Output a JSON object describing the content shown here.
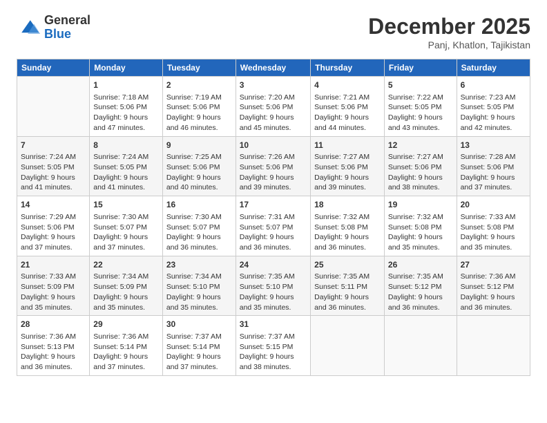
{
  "logo": {
    "general": "General",
    "blue": "Blue"
  },
  "title": "December 2025",
  "subtitle": "Panj, Khatlon, Tajikistan",
  "days_header": [
    "Sunday",
    "Monday",
    "Tuesday",
    "Wednesday",
    "Thursday",
    "Friday",
    "Saturday"
  ],
  "weeks": [
    [
      {
        "day": "",
        "lines": []
      },
      {
        "day": "1",
        "lines": [
          "Sunrise: 7:18 AM",
          "Sunset: 5:06 PM",
          "Daylight: 9 hours",
          "and 47 minutes."
        ]
      },
      {
        "day": "2",
        "lines": [
          "Sunrise: 7:19 AM",
          "Sunset: 5:06 PM",
          "Daylight: 9 hours",
          "and 46 minutes."
        ]
      },
      {
        "day": "3",
        "lines": [
          "Sunrise: 7:20 AM",
          "Sunset: 5:06 PM",
          "Daylight: 9 hours",
          "and 45 minutes."
        ]
      },
      {
        "day": "4",
        "lines": [
          "Sunrise: 7:21 AM",
          "Sunset: 5:06 PM",
          "Daylight: 9 hours",
          "and 44 minutes."
        ]
      },
      {
        "day": "5",
        "lines": [
          "Sunrise: 7:22 AM",
          "Sunset: 5:05 PM",
          "Daylight: 9 hours",
          "and 43 minutes."
        ]
      },
      {
        "day": "6",
        "lines": [
          "Sunrise: 7:23 AM",
          "Sunset: 5:05 PM",
          "Daylight: 9 hours",
          "and 42 minutes."
        ]
      }
    ],
    [
      {
        "day": "7",
        "lines": [
          "Sunrise: 7:24 AM",
          "Sunset: 5:05 PM",
          "Daylight: 9 hours",
          "and 41 minutes."
        ]
      },
      {
        "day": "8",
        "lines": [
          "Sunrise: 7:24 AM",
          "Sunset: 5:05 PM",
          "Daylight: 9 hours",
          "and 41 minutes."
        ]
      },
      {
        "day": "9",
        "lines": [
          "Sunrise: 7:25 AM",
          "Sunset: 5:06 PM",
          "Daylight: 9 hours",
          "and 40 minutes."
        ]
      },
      {
        "day": "10",
        "lines": [
          "Sunrise: 7:26 AM",
          "Sunset: 5:06 PM",
          "Daylight: 9 hours",
          "and 39 minutes."
        ]
      },
      {
        "day": "11",
        "lines": [
          "Sunrise: 7:27 AM",
          "Sunset: 5:06 PM",
          "Daylight: 9 hours",
          "and 39 minutes."
        ]
      },
      {
        "day": "12",
        "lines": [
          "Sunrise: 7:27 AM",
          "Sunset: 5:06 PM",
          "Daylight: 9 hours",
          "and 38 minutes."
        ]
      },
      {
        "day": "13",
        "lines": [
          "Sunrise: 7:28 AM",
          "Sunset: 5:06 PM",
          "Daylight: 9 hours",
          "and 37 minutes."
        ]
      }
    ],
    [
      {
        "day": "14",
        "lines": [
          "Sunrise: 7:29 AM",
          "Sunset: 5:06 PM",
          "Daylight: 9 hours",
          "and 37 minutes."
        ]
      },
      {
        "day": "15",
        "lines": [
          "Sunrise: 7:30 AM",
          "Sunset: 5:07 PM",
          "Daylight: 9 hours",
          "and 37 minutes."
        ]
      },
      {
        "day": "16",
        "lines": [
          "Sunrise: 7:30 AM",
          "Sunset: 5:07 PM",
          "Daylight: 9 hours",
          "and 36 minutes."
        ]
      },
      {
        "day": "17",
        "lines": [
          "Sunrise: 7:31 AM",
          "Sunset: 5:07 PM",
          "Daylight: 9 hours",
          "and 36 minutes."
        ]
      },
      {
        "day": "18",
        "lines": [
          "Sunrise: 7:32 AM",
          "Sunset: 5:08 PM",
          "Daylight: 9 hours",
          "and 36 minutes."
        ]
      },
      {
        "day": "19",
        "lines": [
          "Sunrise: 7:32 AM",
          "Sunset: 5:08 PM",
          "Daylight: 9 hours",
          "and 35 minutes."
        ]
      },
      {
        "day": "20",
        "lines": [
          "Sunrise: 7:33 AM",
          "Sunset: 5:08 PM",
          "Daylight: 9 hours",
          "and 35 minutes."
        ]
      }
    ],
    [
      {
        "day": "21",
        "lines": [
          "Sunrise: 7:33 AM",
          "Sunset: 5:09 PM",
          "Daylight: 9 hours",
          "and 35 minutes."
        ]
      },
      {
        "day": "22",
        "lines": [
          "Sunrise: 7:34 AM",
          "Sunset: 5:09 PM",
          "Daylight: 9 hours",
          "and 35 minutes."
        ]
      },
      {
        "day": "23",
        "lines": [
          "Sunrise: 7:34 AM",
          "Sunset: 5:10 PM",
          "Daylight: 9 hours",
          "and 35 minutes."
        ]
      },
      {
        "day": "24",
        "lines": [
          "Sunrise: 7:35 AM",
          "Sunset: 5:10 PM",
          "Daylight: 9 hours",
          "and 35 minutes."
        ]
      },
      {
        "day": "25",
        "lines": [
          "Sunrise: 7:35 AM",
          "Sunset: 5:11 PM",
          "Daylight: 9 hours",
          "and 36 minutes."
        ]
      },
      {
        "day": "26",
        "lines": [
          "Sunrise: 7:35 AM",
          "Sunset: 5:12 PM",
          "Daylight: 9 hours",
          "and 36 minutes."
        ]
      },
      {
        "day": "27",
        "lines": [
          "Sunrise: 7:36 AM",
          "Sunset: 5:12 PM",
          "Daylight: 9 hours",
          "and 36 minutes."
        ]
      }
    ],
    [
      {
        "day": "28",
        "lines": [
          "Sunrise: 7:36 AM",
          "Sunset: 5:13 PM",
          "Daylight: 9 hours",
          "and 36 minutes."
        ]
      },
      {
        "day": "29",
        "lines": [
          "Sunrise: 7:36 AM",
          "Sunset: 5:14 PM",
          "Daylight: 9 hours",
          "and 37 minutes."
        ]
      },
      {
        "day": "30",
        "lines": [
          "Sunrise: 7:37 AM",
          "Sunset: 5:14 PM",
          "Daylight: 9 hours",
          "and 37 minutes."
        ]
      },
      {
        "day": "31",
        "lines": [
          "Sunrise: 7:37 AM",
          "Sunset: 5:15 PM",
          "Daylight: 9 hours",
          "and 38 minutes."
        ]
      },
      {
        "day": "",
        "lines": []
      },
      {
        "day": "",
        "lines": []
      },
      {
        "day": "",
        "lines": []
      }
    ]
  ]
}
